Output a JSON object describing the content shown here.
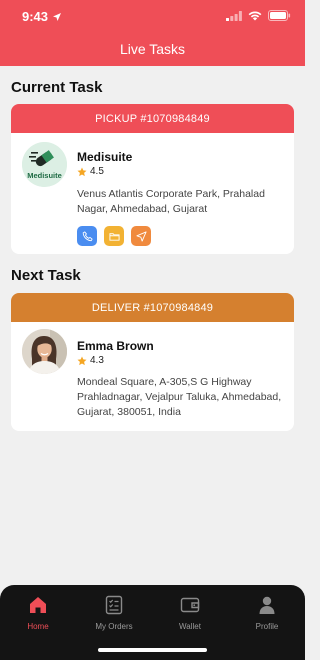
{
  "status_bar": {
    "time": "9:43"
  },
  "header": {
    "title": "Live Tasks"
  },
  "current_task": {
    "section_title": "Current Task",
    "head_label": "PICKUP #1070984849",
    "head_color": "#ef4e57",
    "name": "Medisuite",
    "rating": "4.5",
    "logo_text": "Medisuite",
    "address": "Venus Atlantis Corporate Park, Prahalad Nagar, Ahmedabad, Gujarat",
    "actions": [
      {
        "icon": "phone-icon",
        "color": "#4a8df0"
      },
      {
        "icon": "folder-icon",
        "color": "#f2b233"
      },
      {
        "icon": "navigate-icon",
        "color": "#f08a3e"
      }
    ]
  },
  "next_task": {
    "section_title": "Next Task",
    "head_label": "DELIVER #1070984849",
    "head_color": "#d5802f",
    "name": "Emma Brown",
    "rating": "4.3",
    "address": "Mondeal Square, A-305,S G Highway Prahladnagar, Vejalpur Taluka, Ahmedabad, Gujarat, 380051, India"
  },
  "tabbar": {
    "items": [
      {
        "label": "Home",
        "icon": "home-icon",
        "active": true
      },
      {
        "label": "My Orders",
        "icon": "orders-icon",
        "active": false
      },
      {
        "label": "Wallet",
        "icon": "wallet-icon",
        "active": false
      },
      {
        "label": "Profile",
        "icon": "profile-icon",
        "active": false
      }
    ]
  },
  "colors": {
    "accent": "#ef4e57",
    "deliver": "#d5802f",
    "star": "#f5a623"
  }
}
